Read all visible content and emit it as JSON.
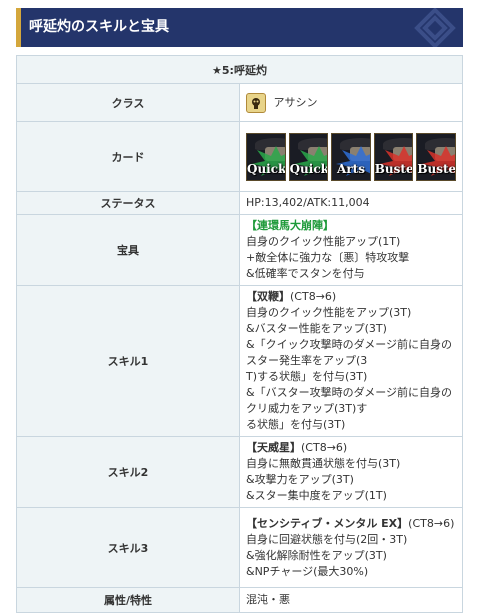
{
  "header": {
    "title": "呼延灼のスキルと宝具"
  },
  "table": {
    "title": "★5:呼延灼",
    "class": {
      "label": "クラス",
      "value": "アサシン",
      "icon": "assassin-class-icon"
    },
    "cards": {
      "label": "カード",
      "items": [
        {
          "label": "Quick",
          "color": "#2aa84a"
        },
        {
          "label": "Quick",
          "color": "#2aa84a"
        },
        {
          "label": "Arts",
          "color": "#2f6fd6"
        },
        {
          "label": "Buster",
          "color": "#d8322a"
        },
        {
          "label": "Buster",
          "color": "#d8322a"
        }
      ]
    },
    "status": {
      "label": "ステータス",
      "value": "HP:13,402/ATK:11,004"
    },
    "np": {
      "label": "宝具",
      "name": "【連環馬大崩陣】",
      "lines": [
        "自身のクイック性能アップ(1T)",
        "+敵全体に強力な〔悪〕特攻攻撃",
        "&低確率でスタンを付与"
      ]
    },
    "skill1": {
      "label": "スキル1",
      "name": "【双鞭】",
      "ct": "(CT8→6)",
      "lines": [
        "自身のクイック性能をアップ(3T)",
        "&バスター性能をアップ(3T)",
        "&「クイック攻撃時のダメージ前に自身のスター発生率をアップ(3",
        "T)する状態」を付与(3T)",
        "&「バスター攻撃時のダメージ前に自身のクリ威力をアップ(3T)す",
        "る状態」を付与(3T)"
      ]
    },
    "skill2": {
      "label": "スキル2",
      "name": "【天威星】",
      "ct": "(CT8→6)",
      "lines": [
        "自身に無敵貫通状態を付与(3T)",
        "&攻撃力をアップ(3T)",
        "&スター集中度をアップ(1T)"
      ]
    },
    "skill3": {
      "label": "スキル3",
      "name": "【センシティブ・メンタル EX】",
      "ct": "(CT8→6)",
      "lines": [
        "自身に回避状態を付与(2回・3T)",
        "&強化解除耐性をアップ(3T)",
        "&NPチャージ(最大30%)"
      ]
    },
    "attributes": {
      "label": "属性/特性",
      "value": "混沌・悪"
    }
  }
}
